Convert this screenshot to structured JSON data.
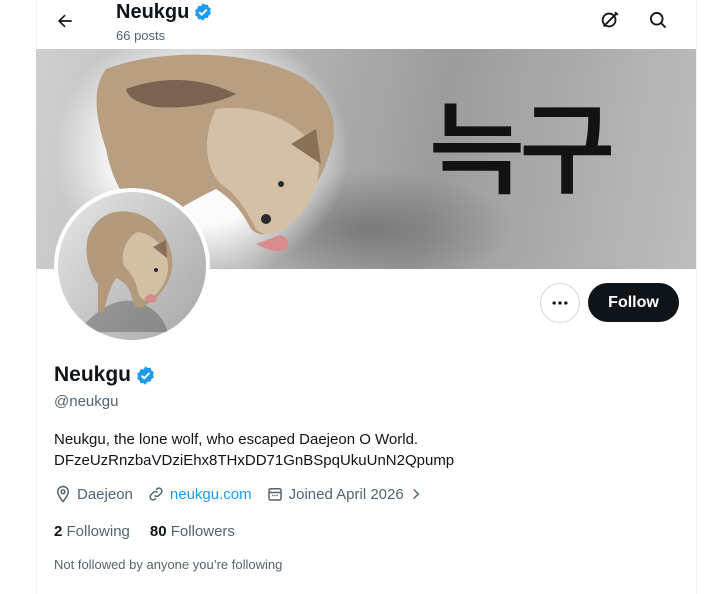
{
  "header": {
    "name": "Neukgu",
    "posts": "66 posts",
    "back_icon": "arrow-left-icon",
    "grok_icon": "grok-icon",
    "search_icon": "search-icon"
  },
  "banner": {
    "text": "늑구"
  },
  "actions": {
    "more_label": "more-horizontal-icon",
    "follow_label": "Follow"
  },
  "profile": {
    "name": "Neukgu",
    "handle": "@neukgu",
    "bio_line1": "Neukgu, the lone wolf, who escaped Daejeon O World.",
    "bio_line2": "DFzeUzRnzbaVDziEhx8THxDD71GnBSpqUkuUnN2Qpump",
    "location": "Daejeon",
    "website": "neukgu.com",
    "joined": "Joined April 2026",
    "following_count": "2",
    "following_label": "Following",
    "followers_count": "80",
    "followers_label": "Followers",
    "followed_by_note": "Not followed by anyone you’re following"
  },
  "colors": {
    "accent": "#1d9bf0",
    "verified": "#1d9bf0",
    "text": "#0f1419",
    "muted": "#536471"
  }
}
